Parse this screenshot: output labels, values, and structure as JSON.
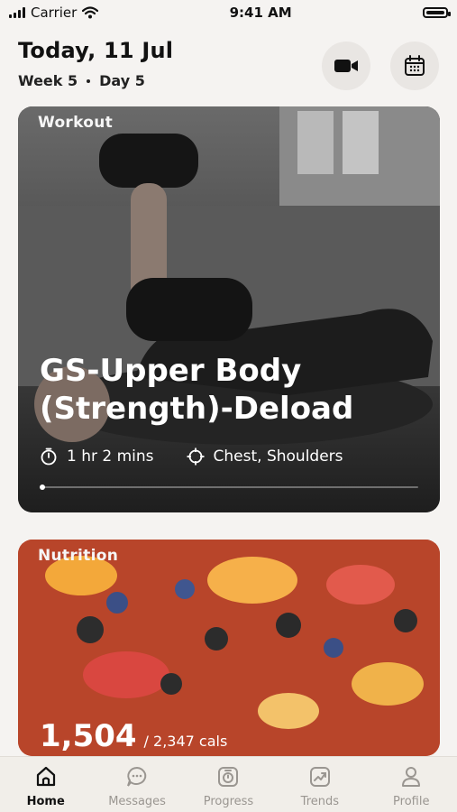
{
  "status": {
    "carrier": "Carrier",
    "time": "9:41 AM"
  },
  "header": {
    "title": "Today, 11 Jul",
    "week": "Week 5",
    "day": "Day 5"
  },
  "icons": {
    "video": "video-camera-icon",
    "calendar": "calendar-icon"
  },
  "workout": {
    "label": "Workout",
    "title": "GS-Upper Body (Strength)-Deload",
    "duration": "1 hr 2 mins",
    "muscles": "Chest, Shoulders",
    "progress": 0
  },
  "nutrition": {
    "label": "Nutrition",
    "calories": "1,504",
    "target": "/ 2,347 cals"
  },
  "tabs": [
    {
      "label": "Home",
      "icon": "home-icon",
      "active": true
    },
    {
      "label": "Messages",
      "icon": "message-icon"
    },
    {
      "label": "Progress",
      "icon": "progress-icon"
    },
    {
      "label": "Trends",
      "icon": "trends-icon"
    },
    {
      "label": "Profile",
      "icon": "profile-icon"
    }
  ]
}
